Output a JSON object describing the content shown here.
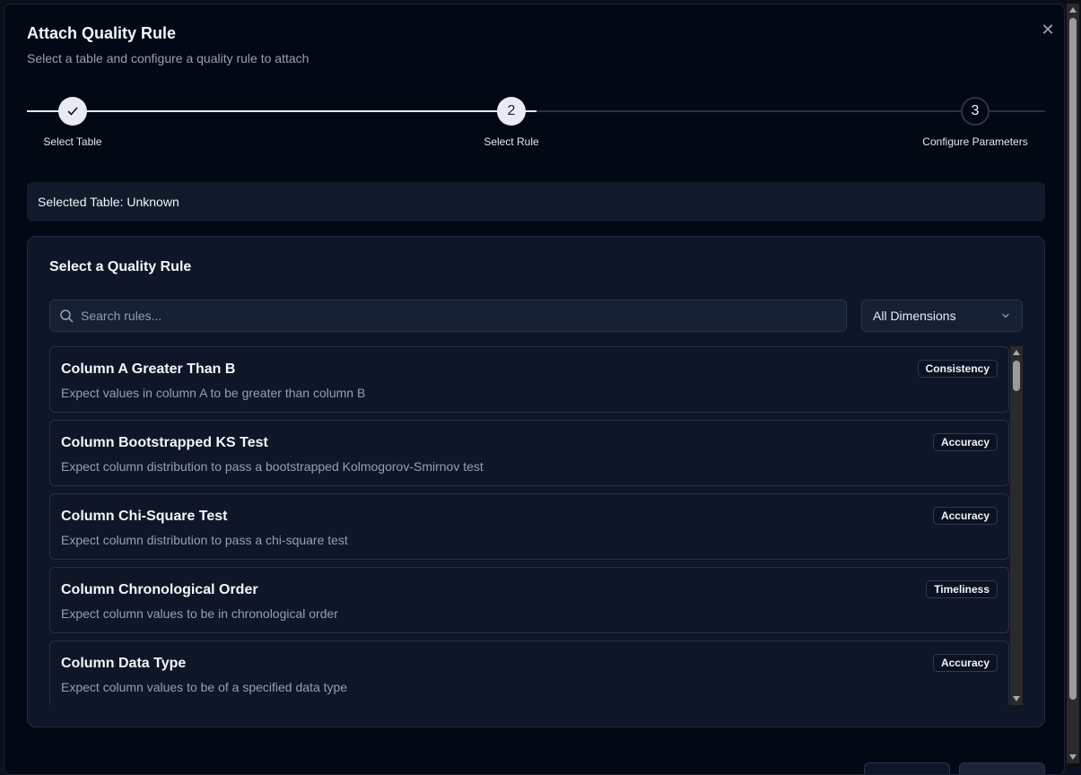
{
  "dialog": {
    "title": "Attach Quality Rule",
    "subtitle": "Select a table and configure a quality rule to attach",
    "close_icon": "close-icon"
  },
  "stepper": {
    "steps": [
      {
        "label": "Select Table",
        "number": "1",
        "state": "done"
      },
      {
        "label": "Select Rule",
        "number": "2",
        "state": "active"
      },
      {
        "label": "Configure Parameters",
        "number": "3",
        "state": "pending"
      }
    ]
  },
  "selected_table": {
    "text": "Selected Table: Unknown"
  },
  "rule_section": {
    "title": "Select a Quality Rule",
    "search_placeholder": "Search rules...",
    "search_value": "",
    "dimension_filter": "All Dimensions",
    "rules": [
      {
        "name": "Column A Greater Than B",
        "description": "Expect values in column A to be greater than column B",
        "dimension": "Consistency"
      },
      {
        "name": "Column Bootstrapped KS Test",
        "description": "Expect column distribution to pass a bootstrapped Kolmogorov-Smirnov test",
        "dimension": "Accuracy"
      },
      {
        "name": "Column Chi-Square Test",
        "description": "Expect column distribution to pass a chi-square test",
        "dimension": "Accuracy"
      },
      {
        "name": "Column Chronological Order",
        "description": "Expect column values to be in chronological order",
        "dimension": "Timeliness"
      },
      {
        "name": "Column Data Type",
        "description": "Expect column values to be of a specified data type",
        "dimension": "Accuracy"
      }
    ]
  },
  "colors": {
    "background": "#030815",
    "card": "#0e1627",
    "accent": "#e8ecf2",
    "muted_text": "#94a0b4"
  }
}
